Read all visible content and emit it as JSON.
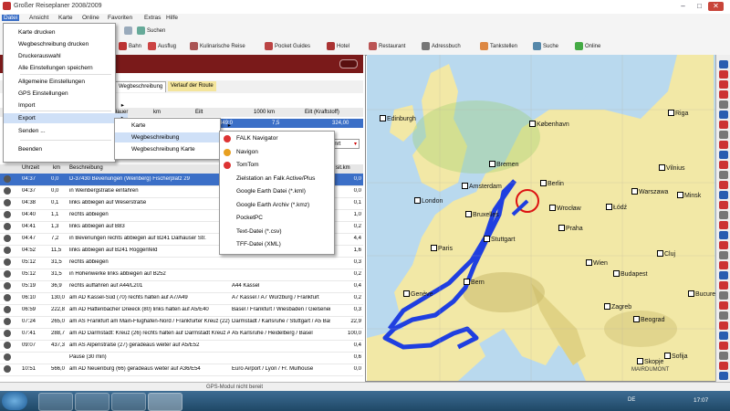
{
  "window": {
    "title": "Großer Reiseplaner 2008/2009",
    "minimize_glyph": "–",
    "maximize_glyph": "□",
    "close_glyph": "✕"
  },
  "menubar": [
    "Datei",
    "Ansicht",
    "Karte",
    "Online",
    "Favoriten",
    "Extras",
    "Hilfe"
  ],
  "toolbar1": {
    "search_label": "Suchen"
  },
  "toolbar2": [
    "Bahn",
    "Ausflug",
    "Kulinarische Reise",
    "Pocket Guides",
    "Hotel",
    "Restaurant",
    "Adressbuch",
    "Tankstellen",
    "Suche",
    "Online"
  ],
  "left_panel": {
    "tabs": [
      "Wegbeschreibung",
      "Verlauf der Route"
    ],
    "summary_headers": [
      "Dauer",
      "km",
      "Eilt",
      "1000 km",
      "Eilt (Kraftstoff)"
    ],
    "summary_row": {
      "label": "Karte",
      "time": "349:0",
      "km": "7,5",
      "cost": "324,00"
    },
    "wegbeschreibung_label": "Wegbeschreibung",
    "sort_select": "Spnrt"
  },
  "route_table": {
    "headers": [
      "Uhrzeit",
      "km",
      "Beschreibung",
      "sit.km"
    ],
    "rows": [
      {
        "time": "04:37",
        "km": "0,0",
        "desc": "D-37430 Bevenungen (Weinberg) Fischerplatz 29",
        "extra": "",
        "skm": "0,0",
        "selected": true
      },
      {
        "time": "04:37",
        "km": "0,0",
        "desc": "in Weinbergstraße einfahren",
        "extra": "",
        "skm": "0,0"
      },
      {
        "time": "04:38",
        "km": "0,1",
        "desc": "links abbiegen auf Weserstraße",
        "extra": "",
        "skm": "0,1"
      },
      {
        "time": "04:40",
        "km": "1,1",
        "desc": "rechts abbiegen",
        "extra": "",
        "skm": "1,0"
      },
      {
        "time": "04:41",
        "km": "1,3",
        "desc": "links abbiegen auf B83",
        "extra": "",
        "skm": "0,2"
      },
      {
        "time": "04:47",
        "km": "7,2",
        "desc": "in Bevenungen rechts abbiegen auf B241 Dalhauser Str.",
        "extra": "",
        "skm": "4,4"
      },
      {
        "time": "04:52",
        "km": "11,5",
        "desc": "links abbiegen auf B241 Roggenfeld",
        "extra": "",
        "skm": "1,6"
      },
      {
        "time": "05:12",
        "km": "31,5",
        "desc": "rechts abbiegen",
        "extra": "",
        "skm": "0,3"
      },
      {
        "time": "05:12",
        "km": "31,5",
        "desc": "in Hohenwerke links abbiegen auf B252",
        "extra": "",
        "skm": "0,2"
      },
      {
        "time": "05:19",
        "km": "36,9",
        "desc": "rechts auffahren auf A44/L201",
        "extra": "A44 Kassel",
        "skm": "0,4"
      },
      {
        "time": "06:10",
        "km": "130,0",
        "desc": "am AD Kassel-Süd (70) rechts halten auf A7/A49",
        "extra": "A7 Kassel / A7 Würzburg / Frankfurt",
        "skm": "0,2"
      },
      {
        "time": "06:59",
        "km": "222,8",
        "desc": "am AD Hattenbacher Dreieck (80) links halten auf A5/E40",
        "extra": "Basel / Frankfurt / Wiesbaden / Gießener AS",
        "skm": "0,3"
      },
      {
        "time": "07:24",
        "km": "265,0",
        "desc": "am AS Frankfurt am Main-Flughafen-Nord / Frankfurter Kreuz (22) links halten auf A5/E451",
        "extra": "Darmstadt / Karlsruhe / Stuttgart / A5 Basel",
        "skm": "22,9"
      },
      {
        "time": "07:41",
        "km": "288,7",
        "desc": "am AD Darmstadt: Kreuz (26) rechts halten auf Darmstadt Kreuz A5",
        "extra": "A5 Karlsruhe / Heidelberg / Basel",
        "skm": "100,0"
      },
      {
        "time": "09:07",
        "km": "437,3",
        "desc": "am AS Alpenstraße (27) geradeaus weiter auf A5/E52",
        "extra": "",
        "skm": "0,4"
      },
      {
        "time": "",
        "km": "",
        "desc": "Pause (30 min)",
        "extra": "",
        "skm": "0,6"
      },
      {
        "time": "10:51",
        "km": "566,0",
        "desc": "am AD Neuenburg (66) geradeaus weiter auf A36/E54",
        "extra": "Euro Airport / Lyon / Fr. Mulhouse",
        "skm": "0,0"
      }
    ]
  },
  "datei_menu": {
    "items": [
      "Karte drucken",
      "Wegbeschreibung drucken",
      "Druckerauswahl",
      "Alle Einstellungen speichern",
      "Allgemeine Einstellungen",
      "GPS Einstellungen",
      "Import",
      "Export",
      "Senden ...",
      "Beenden"
    ],
    "selected_index": 7
  },
  "export_menu": {
    "items": [
      "Karte",
      "Wegbeschreibung",
      "Wegbeschreibung Karte"
    ],
    "selected_index": 1
  },
  "wegbeschreibung_menu": {
    "items": [
      "FALK Navigator",
      "Navigon",
      "TomTom",
      "Zielstation an Falk Active/Plus",
      "Google Earth Datei (*.kml)",
      "Google Earth Archiv (*.kmz)",
      "PocketPC",
      "Text-Datei (*.csv)",
      "TFF-Datei (XML)"
    ]
  },
  "map": {
    "cities": [
      {
        "name": "Edinburgh"
      },
      {
        "name": "London"
      },
      {
        "name": "Amsterdam"
      },
      {
        "name": "Bruxelles"
      },
      {
        "name": "Paris"
      },
      {
        "name": "Bremen"
      },
      {
        "name": "Berlin"
      },
      {
        "name": "Warszawa"
      },
      {
        "name": "Wrocław"
      },
      {
        "name": "Praha"
      },
      {
        "name": "Stuttgart"
      },
      {
        "name": "Bern"
      },
      {
        "name": "Wien"
      },
      {
        "name": "Budapest"
      },
      {
        "name": "Zagreb"
      },
      {
        "name": "Beograd"
      },
      {
        "name": "København"
      },
      {
        "name": "Vilnius"
      },
      {
        "name": "Minsk"
      },
      {
        "name": "Łódź"
      },
      {
        "name": "Riga"
      },
      {
        "name": "Skopje"
      },
      {
        "name": "Sofija"
      },
      {
        "name": "Genève"
      },
      {
        "name": "Cluj"
      },
      {
        "name": "Bucureşti"
      }
    ],
    "scale_label": "MAIRDUMONT"
  },
  "statusbar": {
    "text": "GPS-Modul nicht bereit"
  },
  "taskbar": {
    "clock": "17:07",
    "lang": "DE"
  },
  "colors": {
    "header": "#7a1a1a",
    "route": "#1f3fe0",
    "select": "#3b6fc7",
    "map_land": "#f2e8a6"
  }
}
